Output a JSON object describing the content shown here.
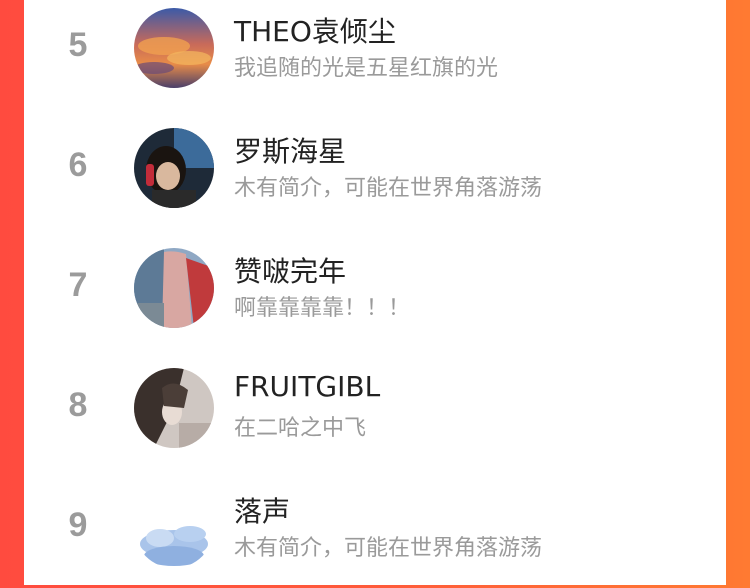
{
  "ranking": {
    "items": [
      {
        "rank": "5",
        "name": "THEO袁倾尘",
        "bio": "我追随的光是五星红旗的光",
        "avatar": "sunset-clouds-avatar"
      },
      {
        "rank": "6",
        "name": "罗斯海星",
        "bio": "木有简介，可能在世界角落游荡",
        "avatar": "person-selfie-avatar"
      },
      {
        "rank": "7",
        "name": "赞啵完年",
        "bio": "啊靠靠靠靠！！！",
        "avatar": "person-long-hair-avatar"
      },
      {
        "rank": "8",
        "name": "FRUITGIBL",
        "bio": "在二哈之中飞",
        "avatar": "anime-character-avatar"
      },
      {
        "rank": "9",
        "name": "落声",
        "bio": "木有简介，可能在世界角落游荡",
        "avatar": "sky-clouds-avatar"
      }
    ]
  },
  "colors": {
    "background_left": "#ff4b3f",
    "background_right": "#ff7a32",
    "rank": "#9b9b9b",
    "name": "#222222",
    "bio": "#9a9a9a"
  }
}
